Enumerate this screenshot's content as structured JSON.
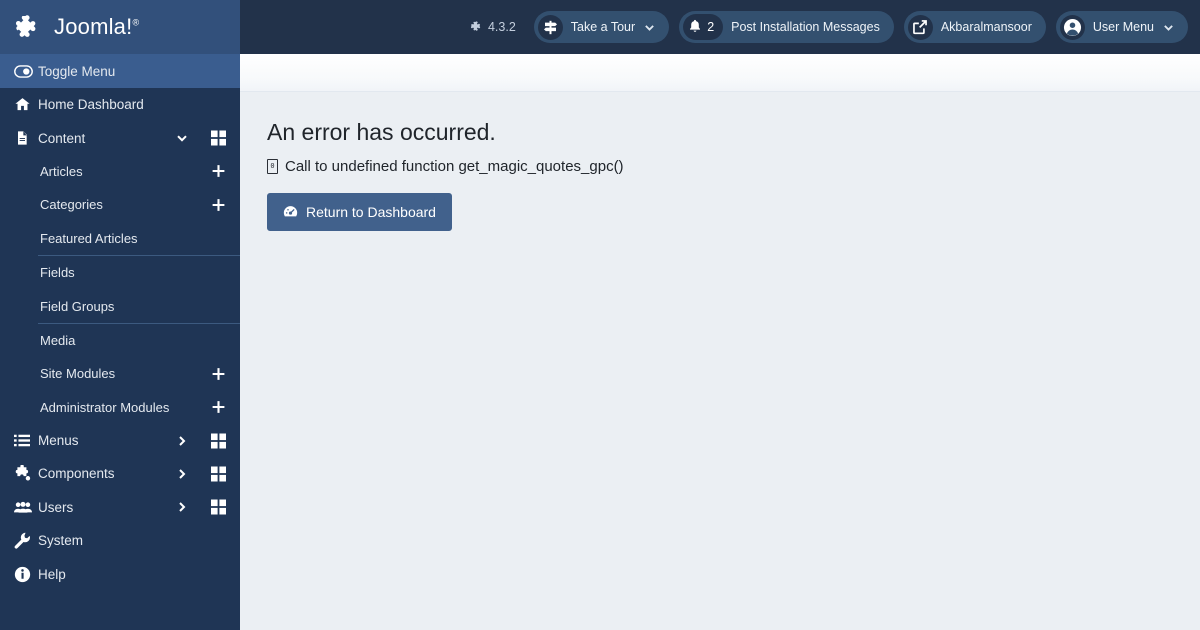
{
  "brand": {
    "name": "Joomla!",
    "registered": "®",
    "logo_icon": "joomla-logo-icon"
  },
  "sidebar": {
    "items": [
      {
        "label": "Toggle Menu",
        "icon": "toggle-icon",
        "state": "active",
        "kind": "toggle"
      },
      {
        "label": "Home Dashboard",
        "icon": "home-icon",
        "kind": "item"
      },
      {
        "label": "Content",
        "icon": "document-icon",
        "kind": "item",
        "chevron": "chevron-down-icon",
        "grid": "grid-icon"
      },
      {
        "label": "Articles",
        "kind": "sub",
        "plus": "plus-icon"
      },
      {
        "label": "Categories",
        "kind": "sub",
        "plus": "plus-icon"
      },
      {
        "label": "Featured Articles",
        "kind": "sub"
      },
      {
        "label": "Fields",
        "kind": "sub",
        "divider_before": true
      },
      {
        "label": "Field Groups",
        "kind": "sub"
      },
      {
        "label": "Media",
        "kind": "sub",
        "divider_before": true
      },
      {
        "label": "Site Modules",
        "kind": "sub",
        "plus": "plus-icon"
      },
      {
        "label": "Administrator Modules",
        "kind": "sub",
        "plus": "plus-icon"
      },
      {
        "label": "Menus",
        "icon": "list-icon",
        "kind": "item",
        "chevron": "chevron-right-icon",
        "grid": "grid-icon"
      },
      {
        "label": "Components",
        "icon": "puzzle-icon",
        "kind": "item",
        "chevron": "chevron-right-icon",
        "grid": "grid-icon"
      },
      {
        "label": "Users",
        "icon": "users-icon",
        "kind": "item",
        "chevron": "chevron-right-icon",
        "grid": "grid-icon"
      },
      {
        "label": "System",
        "icon": "wrench-icon",
        "kind": "item"
      },
      {
        "label": "Help",
        "icon": "info-icon",
        "kind": "item"
      }
    ]
  },
  "topbar": {
    "version_label": "4.3.2",
    "version_icon": "joomla-mark-icon",
    "take_a_tour": {
      "label": "Take a Tour",
      "icon": "signpost-icon",
      "caret": "chevron-down-icon"
    },
    "notifications": {
      "count": "2",
      "label": "Post Installation Messages",
      "icon": "bell-icon"
    },
    "site_link": {
      "label": "Akbaralmansoor",
      "icon": "external-link-icon"
    },
    "user_menu": {
      "label": "User Menu",
      "icon": "user-circle-icon",
      "caret": "chevron-down-icon"
    }
  },
  "main": {
    "error_title": "An error has occurred.",
    "error_bullet": "0",
    "error_message": "Call to undefined function get_magic_quotes_gpc()",
    "return_button": {
      "label": "Return to Dashboard",
      "icon": "dashboard-icon"
    }
  },
  "colors": {
    "sidebar_bg": "#1f3555",
    "brand_bg": "#32507b",
    "active_bg": "#3a5d8f",
    "topbar_bg": "#22324a",
    "pill_bg": "#33506f",
    "content_bg": "#ebeff3",
    "button_bg": "#41618c"
  }
}
